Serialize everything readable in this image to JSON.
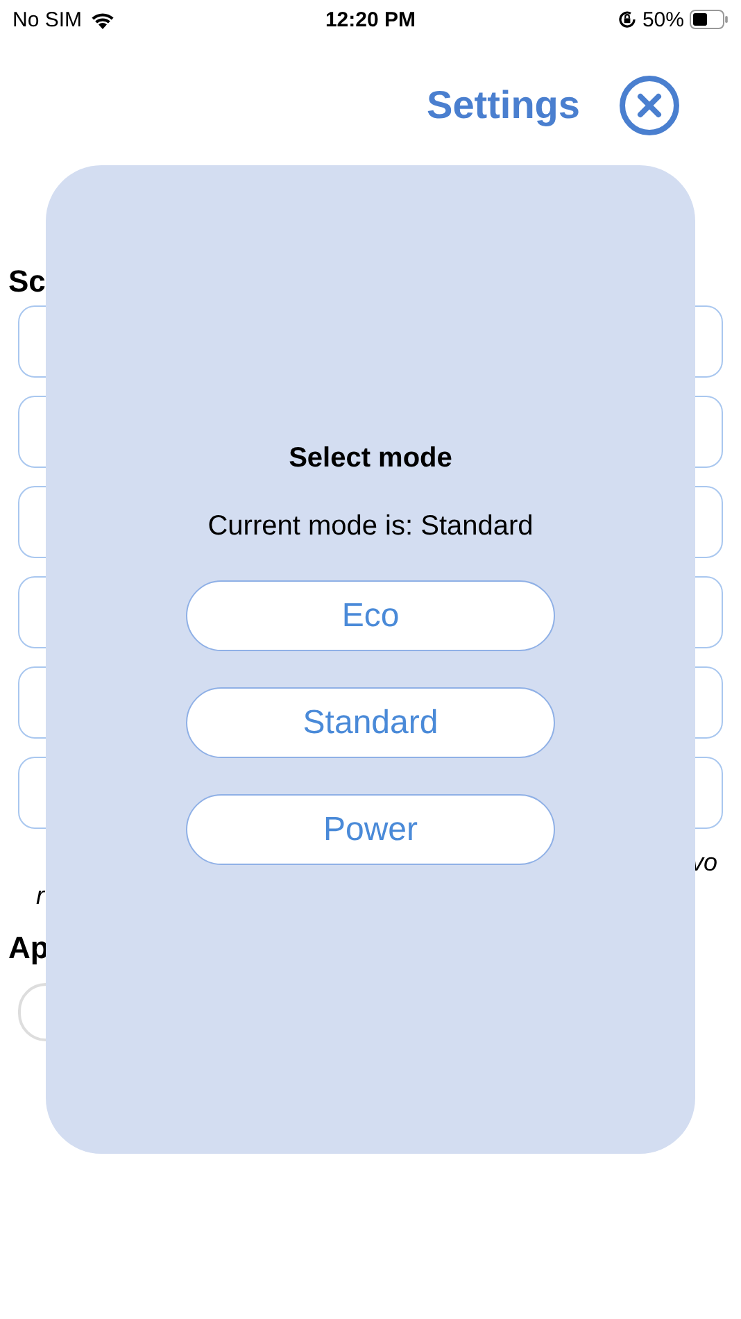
{
  "status_bar": {
    "carrier": "No SIM",
    "time": "12:20 PM",
    "battery": "50%"
  },
  "header": {
    "title": "Settings"
  },
  "background": {
    "section_1_heading": "Sc",
    "boxes": [
      {
        "kind": "field"
      },
      {
        "kind": "field"
      },
      {
        "kind": "field"
      },
      {
        "kind": "field"
      },
      {
        "kind": "field"
      },
      {
        "kind": "field"
      }
    ],
    "note_right": "vo",
    "note_left": "r",
    "section_2_heading": "Ap",
    "toggle": {
      "on": false
    }
  },
  "modal": {
    "title": "Select mode",
    "current": "Current mode is: Standard",
    "options": [
      {
        "label": "Eco"
      },
      {
        "label": "Standard"
      },
      {
        "label": "Power"
      }
    ]
  }
}
